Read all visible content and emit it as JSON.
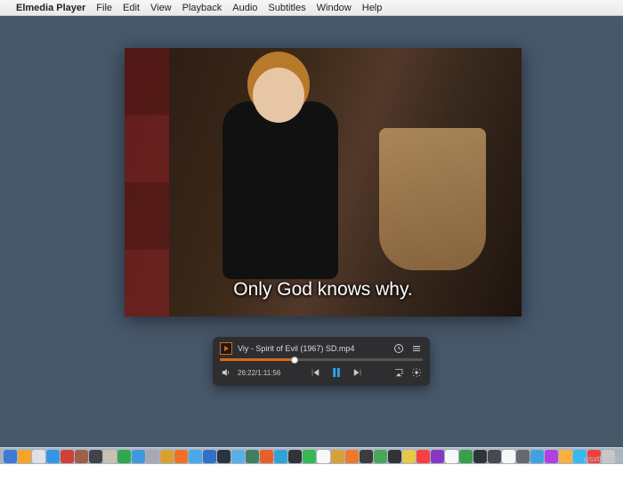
{
  "menubar": {
    "apple": "",
    "appname": "Elmedia Player",
    "items": [
      "File",
      "Edit",
      "View",
      "Playback",
      "Audio",
      "Subtitles",
      "Window",
      "Help"
    ]
  },
  "video": {
    "subtitle": "Only God knows why."
  },
  "player": {
    "title": "Viy - Spirit of Evil (1967) SD.mp4",
    "time": "26:22/1:11:56",
    "progress_percent": 37
  },
  "dock": {
    "colors": [
      "#3b7bd6",
      "#f4a428",
      "#e0e0e8",
      "#3596e8",
      "#d04038",
      "#a06048",
      "#404448",
      "#c8c0b0",
      "#30a850",
      "#4098e0",
      "#a8a8b0",
      "#d8a030",
      "#f07028",
      "#48a8e8",
      "#3070c8",
      "#2a343e",
      "#58b0e8",
      "#408060",
      "#e86028",
      "#34a0d8",
      "#303438",
      "#38b850",
      "#f8f8f8",
      "#d8a038",
      "#f07828",
      "#3c3c3c",
      "#48a858",
      "#303438",
      "#e8c848",
      "#f84040",
      "#8838c0",
      "#f8f8f8",
      "#38a048",
      "#303438",
      "#484850",
      "#f8f8f8",
      "#686870",
      "#40a0e0",
      "#b040e0",
      "#f8b040",
      "#38b8f0",
      "#f04040",
      "#c8c8c8"
    ]
  },
  "watermark": "wsxth.com"
}
